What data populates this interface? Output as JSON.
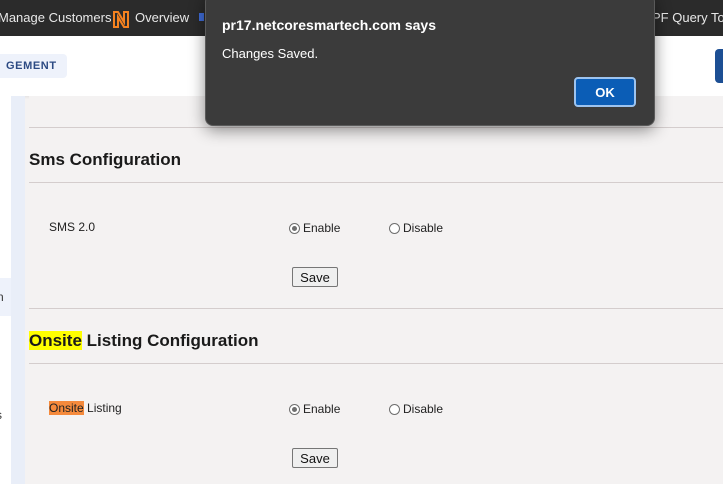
{
  "bookmarks": {
    "manage_customers": "Manage Customers",
    "overview": "Overview",
    "query_tool": "PF Query Tool",
    "overview_icon": "netcore-n-logo-icon",
    "brand_color": "#f58220"
  },
  "header": {
    "management_tab": "GEMENT"
  },
  "sidebar": {
    "fragment_1": "n",
    "fragment_2": "s"
  },
  "sms_section": {
    "title": "Sms Configuration",
    "setting_label": "SMS 2.0",
    "enable_label": "Enable",
    "disable_label": "Disable",
    "selected": "Enable",
    "save_label": "Save"
  },
  "onsite_section": {
    "title_highlight": "Onsite",
    "title_rest": "Listing Configuration",
    "setting_label_highlight": "Onsite",
    "setting_label_rest": "Listing",
    "enable_label": "Enable",
    "disable_label": "Disable",
    "selected": "Enable",
    "save_label": "Save"
  },
  "dialog": {
    "title": "pr17.netcoresmartech.com says",
    "message": "Changes Saved.",
    "ok_label": "OK"
  },
  "colors": {
    "title_highlight": "#ffff00",
    "label_highlight": "#f58a3c",
    "dialog_bg": "#3b3b3b",
    "ok_button": "#0b5db6"
  }
}
